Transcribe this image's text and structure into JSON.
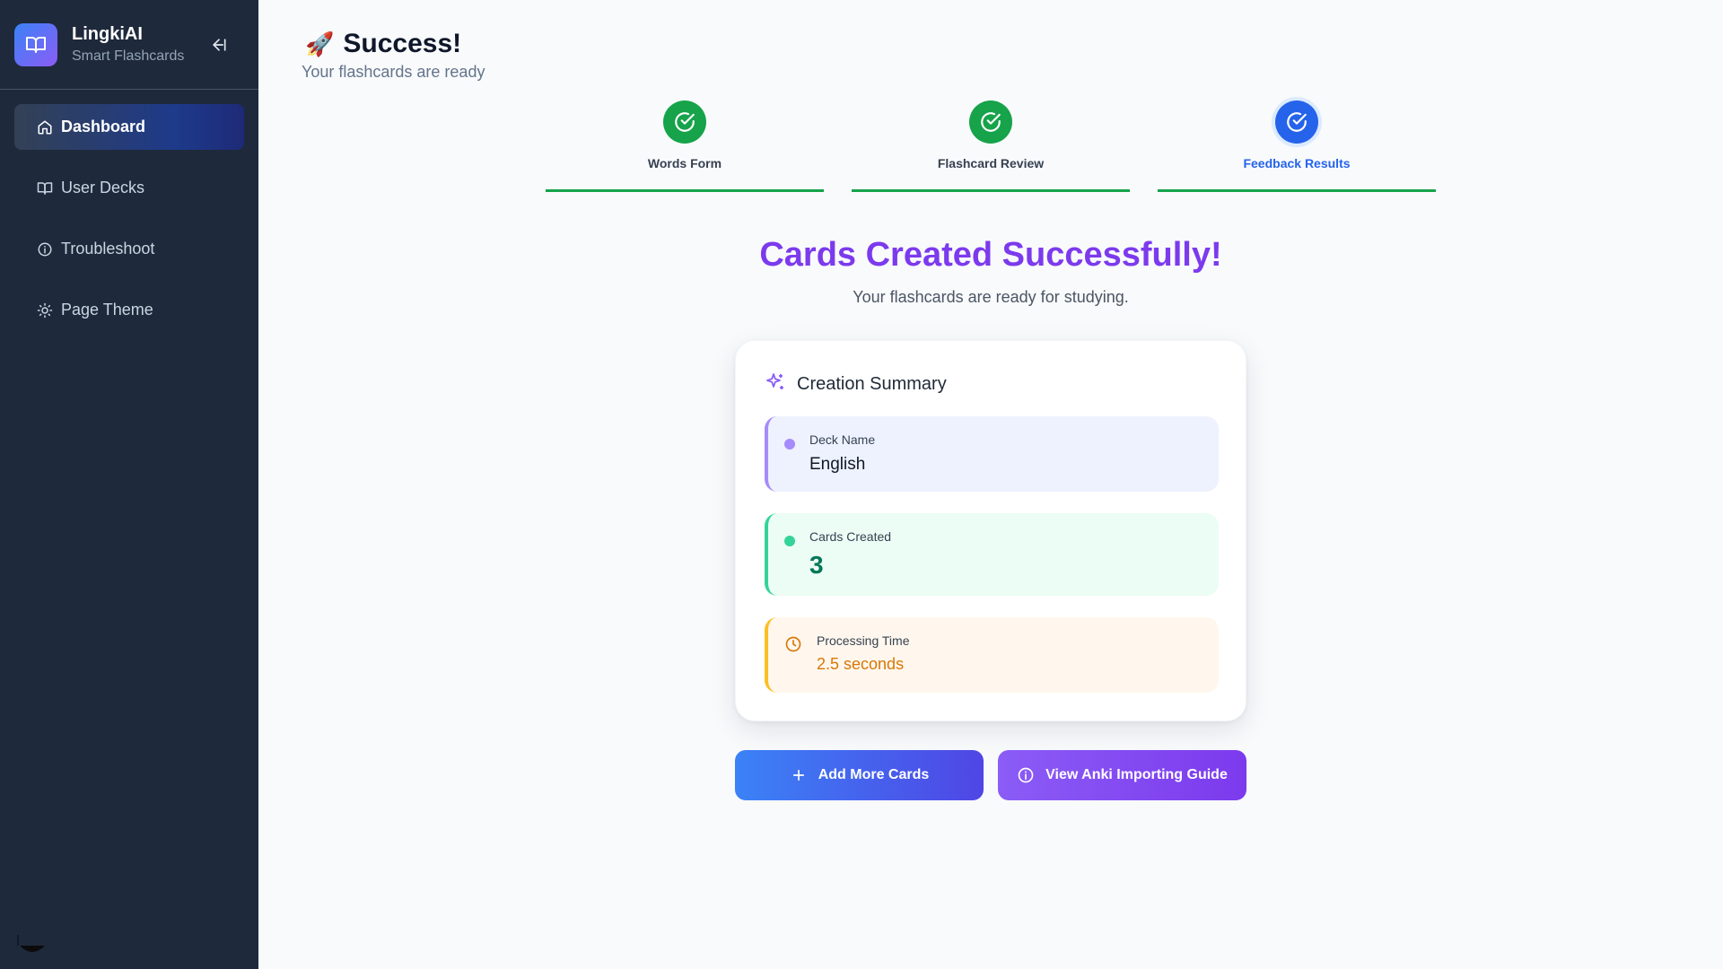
{
  "sidebar": {
    "brand_name": "LingkiAI",
    "brand_subtitle": "Smart Flashcards",
    "items": [
      {
        "label": "Dashboard",
        "icon": "home-icon",
        "active": true
      },
      {
        "label": "User Decks",
        "icon": "book-icon",
        "active": false
      },
      {
        "label": "Troubleshoot",
        "icon": "info-icon",
        "active": false
      },
      {
        "label": "Page Theme",
        "icon": "sun-icon",
        "active": false
      }
    ]
  },
  "header": {
    "icon": "rocket-icon",
    "emoji": "🚀",
    "title": "Success!",
    "subtitle": "Your flashcards are ready"
  },
  "steps": [
    {
      "label": "Words Form",
      "status": "done"
    },
    {
      "label": "Flashcard Review",
      "status": "done"
    },
    {
      "label": "Feedback Results",
      "status": "current"
    }
  ],
  "result": {
    "headline": "Cards Created Successfully!",
    "subheadline": "Your flashcards are ready for studying."
  },
  "summary": {
    "title": "Creation Summary",
    "deck_label": "Deck Name",
    "deck_value": "English",
    "cards_label": "Cards Created",
    "cards_value": "3",
    "time_label": "Processing Time",
    "time_value": "2.5 seconds"
  },
  "buttons": {
    "add_more": "Add More Cards",
    "guide": "View Anki Importing Guide"
  },
  "colors": {
    "sidebar_bg": "#1e293b",
    "success_green": "#16a34a",
    "current_blue": "#2563eb",
    "headline_purple": "#7c3aed",
    "cards_green": "#047857",
    "time_amber": "#d97706"
  }
}
